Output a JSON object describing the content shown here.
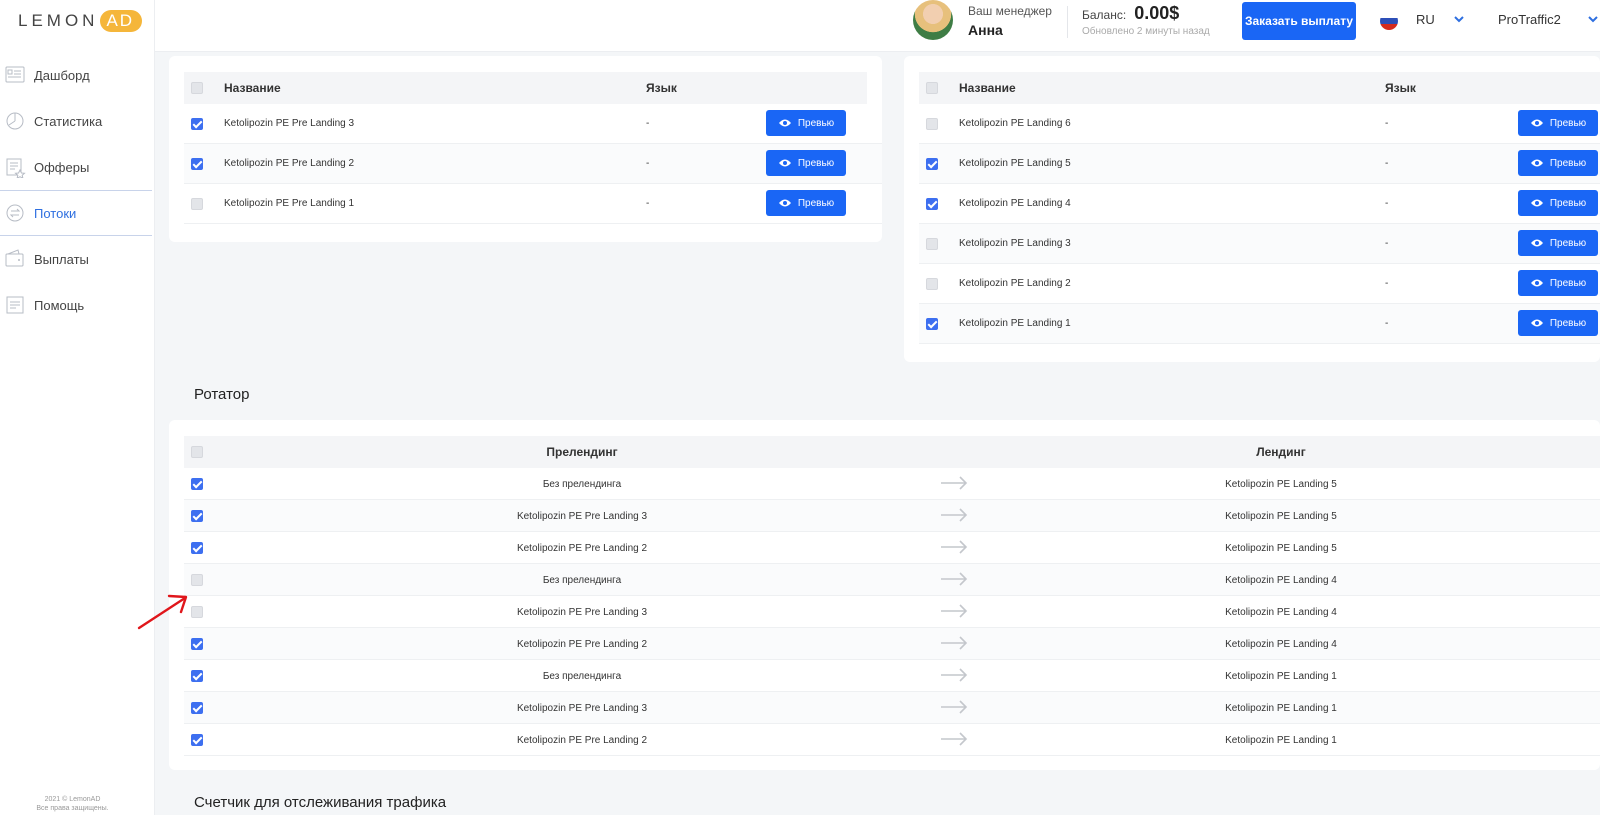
{
  "brand": {
    "lemon": "LEMON",
    "ad": "AD"
  },
  "sidebar": {
    "items": [
      {
        "label": "Дашборд",
        "icon": "dashboard-icon"
      },
      {
        "label": "Статистика",
        "icon": "statistics-icon"
      },
      {
        "label": "Офферы",
        "icon": "offers-icon"
      },
      {
        "label": "Потоки",
        "icon": "streams-icon",
        "active": true
      },
      {
        "label": "Выплаты",
        "icon": "wallet-icon"
      },
      {
        "label": "Помощь",
        "icon": "help-icon"
      }
    ],
    "footer_line1": "2021 © LemonAD",
    "footer_line2": "Все права защищены."
  },
  "header": {
    "manager_label": "Ваш менеджер",
    "manager_name": "Анна",
    "balance_label": "Баланс:",
    "balance_value": "0.00$",
    "updated": "Обновлено 2 минуты назад",
    "payout_button": "Заказать выплату",
    "language": "RU",
    "account": "ProTraffic2"
  },
  "prelanding_table": {
    "col_name": "Название",
    "col_lang": "Язык",
    "preview_label": "Превью",
    "rows": [
      {
        "name": "Ketolipozin PE Pre Landing 3",
        "lang": "-",
        "checked": true
      },
      {
        "name": "Ketolipozin PE Pre Landing 2",
        "lang": "-",
        "checked": true
      },
      {
        "name": "Ketolipozin PE Pre Landing 1",
        "lang": "-",
        "checked": false
      }
    ]
  },
  "landing_table": {
    "col_name": "Название",
    "col_lang": "Язык",
    "preview_label": "Превью",
    "rows": [
      {
        "name": "Ketolipozin PE Landing 6",
        "lang": "-",
        "checked": false
      },
      {
        "name": "Ketolipozin PE Landing 5",
        "lang": "-",
        "checked": true
      },
      {
        "name": "Ketolipozin PE Landing 4",
        "lang": "-",
        "checked": true
      },
      {
        "name": "Ketolipozin PE Landing 3",
        "lang": "-",
        "checked": false
      },
      {
        "name": "Ketolipozin PE Landing 2",
        "lang": "-",
        "checked": false
      },
      {
        "name": "Ketolipozin PE Landing 1",
        "lang": "-",
        "checked": true
      }
    ]
  },
  "rotator": {
    "title": "Ротатор",
    "col_prelanding": "Прелендинг",
    "col_landing": "Лендинг",
    "rows": [
      {
        "pre": "Без прелендинга",
        "land": "Ketolipozin PE Landing 5",
        "checked": true
      },
      {
        "pre": "Ketolipozin PE Pre Landing 3",
        "land": "Ketolipozin PE Landing 5",
        "checked": true
      },
      {
        "pre": "Ketolipozin PE Pre Landing 2",
        "land": "Ketolipozin PE Landing 5",
        "checked": true
      },
      {
        "pre": "Без прелендинга",
        "land": "Ketolipozin PE Landing 4",
        "checked": false
      },
      {
        "pre": "Ketolipozin PE Pre Landing 3",
        "land": "Ketolipozin PE Landing 4",
        "checked": false
      },
      {
        "pre": "Ketolipozin PE Pre Landing 2",
        "land": "Ketolipozin PE Landing 4",
        "checked": true
      },
      {
        "pre": "Без прелендинга",
        "land": "Ketolipozin PE Landing 1",
        "checked": true
      },
      {
        "pre": "Ketolipozin PE Pre Landing 3",
        "land": "Ketolipozin PE Landing 1",
        "checked": true
      },
      {
        "pre": "Ketolipozin PE Pre Landing 2",
        "land": "Ketolipozin PE Landing 1",
        "checked": true
      }
    ]
  },
  "counter_section": {
    "title": "Счетчик для отслеживания трафика"
  },
  "colors": {
    "accent": "#1a66f5",
    "checkbox": "#3d6ff0",
    "brand": "#f5b63a",
    "annotation": "#e0161b"
  }
}
